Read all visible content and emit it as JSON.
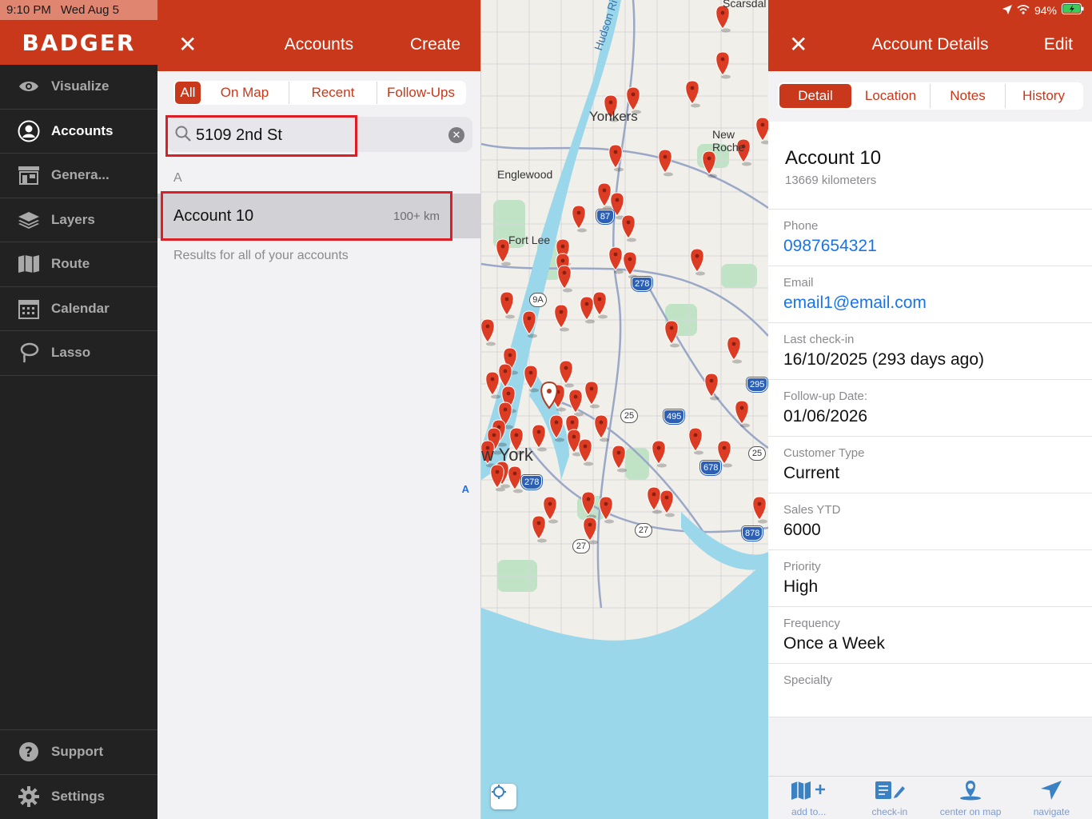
{
  "status": {
    "time": "9:10 PM",
    "date": "Wed Aug 5",
    "battery": "94%"
  },
  "brand": "BADGER",
  "sidebar": {
    "items": [
      {
        "label": "Visualize",
        "icon": "eye-icon"
      },
      {
        "label": "Accounts",
        "icon": "user-circle-icon",
        "active": true
      },
      {
        "label": "Genera...",
        "icon": "storefront-icon"
      },
      {
        "label": "Layers",
        "icon": "layers-icon"
      },
      {
        "label": "Route",
        "icon": "map-icon"
      },
      {
        "label": "Calendar",
        "icon": "calendar-icon"
      },
      {
        "label": "Lasso",
        "icon": "lasso-icon"
      }
    ],
    "bottom": [
      {
        "label": "Support",
        "icon": "help-icon"
      },
      {
        "label": "Settings",
        "icon": "gear-icon"
      }
    ]
  },
  "accounts_panel": {
    "title": "Accounts",
    "create_label": "Create",
    "close_glyph": "✕",
    "tabs": [
      "All",
      "On Map",
      "Recent",
      "Follow-Ups"
    ],
    "search": {
      "value": "5109 2nd St"
    },
    "section_letter": "A",
    "result": {
      "name": "Account 10",
      "distance": "100+ km"
    },
    "results_note": "Results for all of your accounts",
    "index_letter": "A"
  },
  "map": {
    "labels": [
      "Scarsdal",
      "Hudson River",
      "Yonkers",
      "New Roche",
      "Englewood",
      "Fort Lee",
      "w York"
    ],
    "shields": [
      "87",
      "278",
      "9A",
      "295",
      "495",
      "25",
      "678",
      "25",
      "278",
      "27",
      "27",
      "878"
    ],
    "accent_color": "#dd3c24"
  },
  "details_panel": {
    "title": "Account Details",
    "edit_label": "Edit",
    "close_glyph": "✕",
    "tabs": [
      "Detail",
      "Location",
      "Notes",
      "History"
    ],
    "account_name": "Account 10",
    "account_sub": "13669 kilometers",
    "fields": [
      {
        "label": "Phone",
        "value": "0987654321",
        "link": true
      },
      {
        "label": "Email",
        "value": "email1@email.com",
        "link": true
      },
      {
        "label": "Last check-in",
        "value": "16/10/2025 (293 days ago)"
      },
      {
        "label": "Follow-up Date:",
        "value": "01/06/2026"
      },
      {
        "label": "Customer Type",
        "value": "Current"
      },
      {
        "label": "Sales YTD",
        "value": "6000"
      },
      {
        "label": "Priority",
        "value": "High"
      },
      {
        "label": "Frequency",
        "value": "Once a Week"
      },
      {
        "label": "Specialty",
        "value": ""
      }
    ],
    "toolbar": [
      {
        "label": "add to...",
        "icon": "map-plus-icon"
      },
      {
        "label": "check-in",
        "icon": "checkin-icon"
      },
      {
        "label": "center on map",
        "icon": "person-pin-icon"
      },
      {
        "label": "navigate",
        "icon": "navigate-arrow-icon"
      }
    ]
  }
}
